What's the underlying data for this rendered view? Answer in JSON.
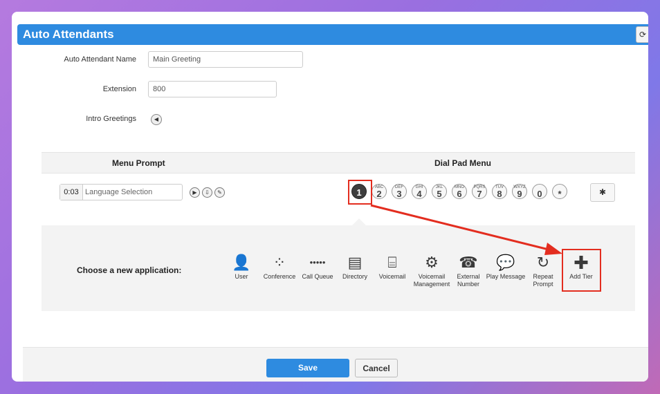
{
  "window": {
    "title": "Auto Attendants",
    "refresh_icon": "refresh-icon"
  },
  "form": {
    "name_label": "Auto Attendant Name",
    "name_value": "Main Greeting",
    "extension_label": "Extension",
    "extension_value": "800",
    "intro_label": "Intro Greetings",
    "speaker_icon": "speaker-icon"
  },
  "menu": {
    "prompt_header": "Menu Prompt",
    "dialpad_header": "Dial Pad Menu",
    "prompt_time": "0:03",
    "prompt_text": "Language Selection",
    "dialpad": [
      {
        "digit": "1",
        "letters": ""
      },
      {
        "digit": "2",
        "letters": "ABC"
      },
      {
        "digit": "3",
        "letters": "DEF"
      },
      {
        "digit": "4",
        "letters": "GHI"
      },
      {
        "digit": "5",
        "letters": "JKL"
      },
      {
        "digit": "6",
        "letters": "MNO"
      },
      {
        "digit": "7",
        "letters": "PQRS"
      },
      {
        "digit": "8",
        "letters": "TUV"
      },
      {
        "digit": "9",
        "letters": "WXYZ"
      },
      {
        "digit": "0",
        "letters": ""
      },
      {
        "digit": "*",
        "letters": ""
      }
    ]
  },
  "applications": {
    "label": "Choose a new application:",
    "items": [
      {
        "name": "User",
        "icon": "user-icon"
      },
      {
        "name": "Conference",
        "icon": "conference-icon"
      },
      {
        "name": "Call Queue",
        "icon": "call-queue-icon"
      },
      {
        "name": "Directory",
        "icon": "directory-icon"
      },
      {
        "name": "Voicemail",
        "icon": "voicemail-icon"
      },
      {
        "name": "Voicemail Management",
        "icon": "voicemail-management-icon"
      },
      {
        "name": "External Number",
        "icon": "external-number-icon"
      },
      {
        "name": "Play Message",
        "icon": "play-message-icon"
      },
      {
        "name": "Repeat Prompt",
        "icon": "repeat-prompt-icon"
      },
      {
        "name": "Add Tier",
        "icon": "add-tier-icon"
      }
    ]
  },
  "footer": {
    "save_label": "Save",
    "cancel_label": "Cancel"
  },
  "colors": {
    "accent": "#2e8be0",
    "highlight": "#e32d1f"
  }
}
